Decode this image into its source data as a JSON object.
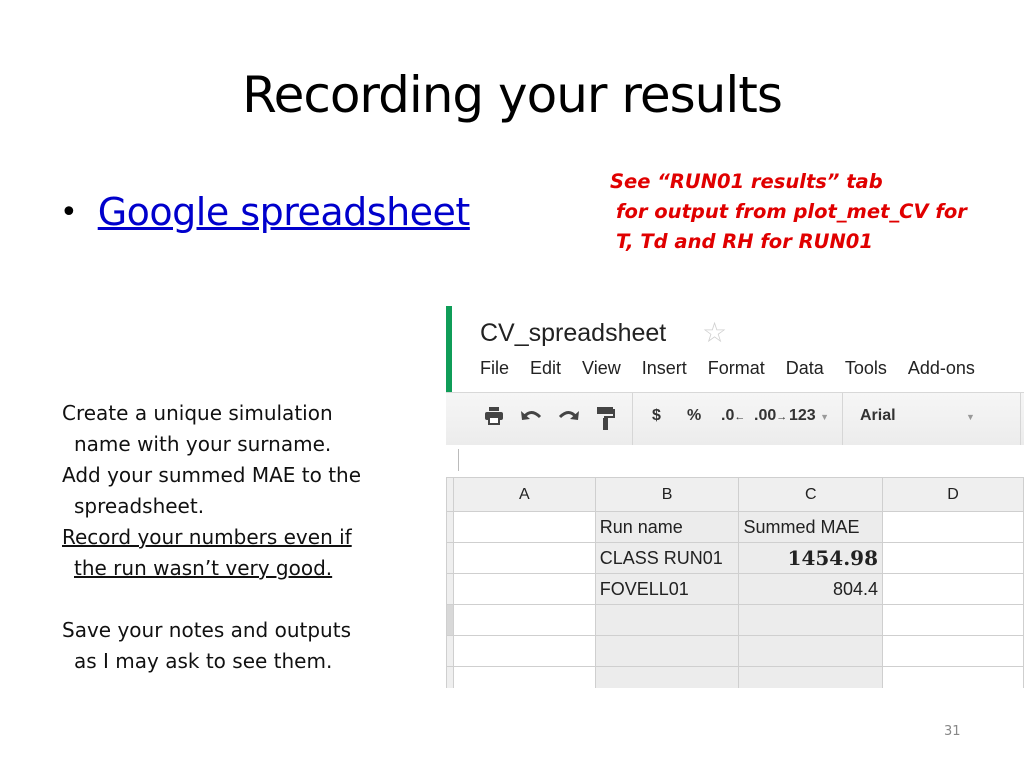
{
  "slide": {
    "title": "Recording your results",
    "bullet_link": "Google spreadsheet",
    "note_lines": [
      "See “RUN01 results” tab",
      "for output from plot_met_CV for",
      "T, Td and RH for RUN01"
    ],
    "instructions": [
      "Create a unique simulation",
      "name with your surname.",
      "Add your summed MAE to the",
      "spreadsheet.",
      "Record your numbers even if",
      "the run wasn’t very good.",
      "Save your notes and outputs",
      "as I may ask to see them."
    ],
    "page_number": "31",
    "colors": {
      "note": "#e00000",
      "link": "#0000cc",
      "sheets_green": "#0f9d58"
    }
  },
  "spreadsheet": {
    "title": "CV_spreadsheet",
    "star_icon": "star-outline-icon",
    "menu": [
      "File",
      "Edit",
      "View",
      "Insert",
      "Format",
      "Data",
      "Tools",
      "Add-ons"
    ],
    "toolbar": {
      "currency": "$",
      "percent": "%",
      "decrease_decimals": ".0",
      "increase_decimals": ".00",
      "more_formats": "123",
      "font": "Arial"
    },
    "columns": [
      "A",
      "B",
      "C",
      "D"
    ],
    "rows": [
      [
        "",
        "Run name",
        "Summed MAE",
        ""
      ],
      [
        "",
        "CLASS RUN01",
        "1454.98",
        ""
      ],
      [
        "",
        "FOVELL01",
        "804.4",
        ""
      ],
      [
        "",
        "",
        "",
        ""
      ],
      [
        "",
        "",
        "",
        ""
      ],
      [
        "",
        "",
        "",
        ""
      ]
    ]
  }
}
